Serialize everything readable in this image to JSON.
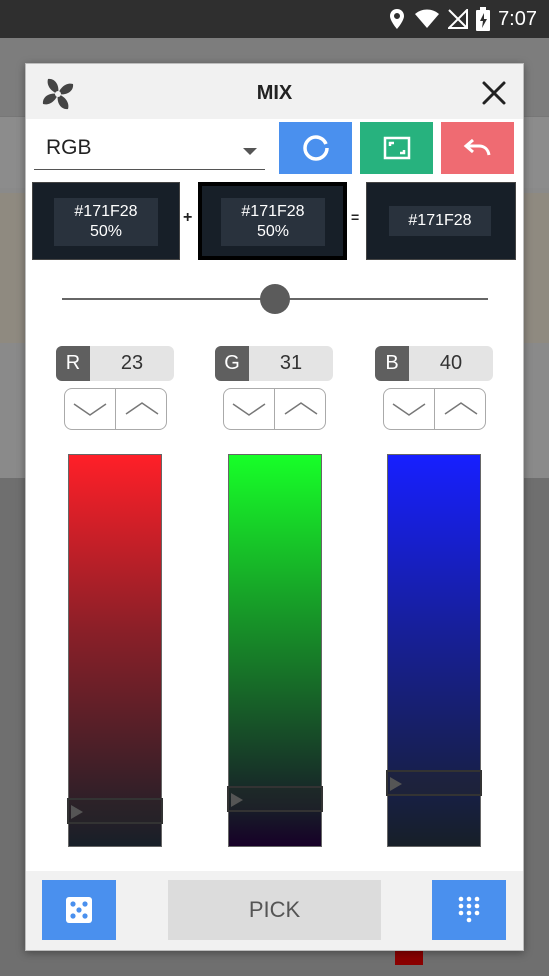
{
  "status_bar": {
    "time": "7:07"
  },
  "dialog": {
    "title": "MIX",
    "mode": {
      "selected": "RGB"
    },
    "swatches": [
      {
        "hex": "#171F28",
        "percent": "50%"
      },
      {
        "hex": "#171F28",
        "percent": "50%"
      },
      {
        "hex": "#171F28"
      }
    ],
    "operators": {
      "plus": "+",
      "equals": "="
    },
    "mix_slider": {
      "value": 0.5
    },
    "channels": [
      {
        "letter": "R",
        "value": "23",
        "level": 0.09
      },
      {
        "letter": "G",
        "value": "31",
        "level": 0.12
      },
      {
        "letter": "B",
        "value": "40",
        "level": 0.16
      }
    ],
    "footer": {
      "pick_label": "PICK"
    }
  },
  "colors": {
    "accent_blue": "#4a90ee",
    "accent_green": "#27b27e",
    "accent_red": "#ef6b72",
    "swatch_color": "#171f28"
  },
  "icons": [
    "fan-logo-icon",
    "close-icon",
    "refresh-icon",
    "frame-icon",
    "undo-icon",
    "chevron-down-icon",
    "chevron-up-icon",
    "dice-icon",
    "keypad-icon",
    "location-icon",
    "wifi-icon",
    "no-signal-icon",
    "battery-icon"
  ]
}
